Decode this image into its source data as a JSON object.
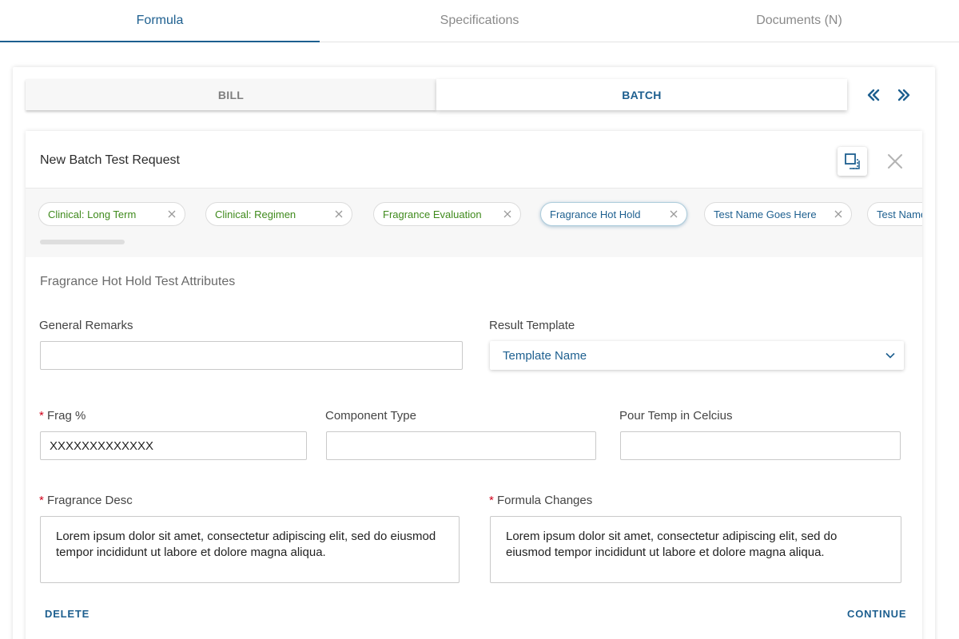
{
  "top_tabs": [
    "Formula",
    "Specifications",
    "Documents (N)"
  ],
  "sub_tabs": {
    "bill": "BILL",
    "batch": "BATCH"
  },
  "panel": {
    "title": "New Batch Test Request"
  },
  "chips": [
    {
      "label": "Clinical: Long Term",
      "color": "#3f8a1c"
    },
    {
      "label": "Clinical: Regimen",
      "color": "#3f8a1c"
    },
    {
      "label": "Fragrance Evaluation",
      "color": "#3f8a1c"
    },
    {
      "label": "Fragrance Hot Hold",
      "color": "#1d5f8f",
      "selected": true
    },
    {
      "label": "Test Name Goes Here",
      "color": "#1d5f8f"
    },
    {
      "label": "Test Name Goes Here",
      "color": "#1d5f8f"
    }
  ],
  "section_title": "Fragrance Hot Hold Test Attributes",
  "fields": {
    "general_remarks": {
      "label": "General Remarks",
      "value": ""
    },
    "result_template": {
      "label": "Result Template",
      "value": "Template Name"
    },
    "frag_pct": {
      "label": "Frag %",
      "value": "XXXXXXXXXXXXX",
      "required": "*"
    },
    "component_type": {
      "label": "Component Type",
      "value": ""
    },
    "pour_temp": {
      "label": "Pour Temp in Celcius",
      "value": ""
    },
    "fragrance_desc": {
      "label": "Fragrance Desc",
      "required": "*",
      "value": "Lorem ipsum dolor sit amet, consectetur adipiscing elit, sed do eiusmod tempor incididunt ut labore et dolore magna aliqua."
    },
    "formula_changes": {
      "label": "Formula Changes",
      "required": "*",
      "value": "Lorem ipsum dolor sit amet, consectetur adipiscing elit, sed do eiusmod tempor incididunt ut labore et dolore magna aliqua."
    }
  },
  "actions": {
    "delete": "DELETE",
    "continue": "CONTINUE"
  },
  "colors": {
    "accent": "#1d5f8f",
    "green": "#3f8a1c",
    "required": "#d0021b"
  }
}
